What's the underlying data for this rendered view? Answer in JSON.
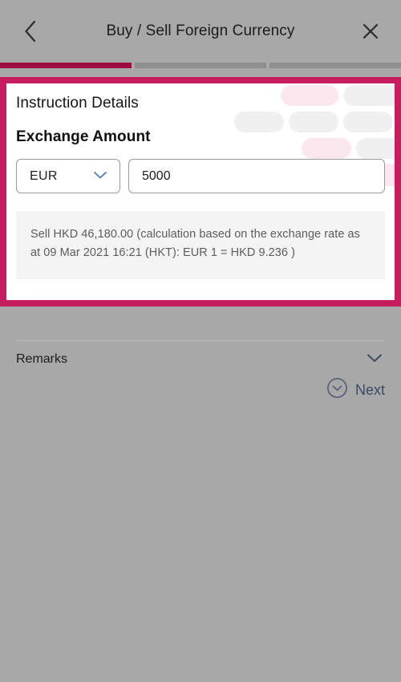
{
  "header": {
    "title": "Buy / Sell Foreign Currency",
    "back_icon": "chevron-left-icon",
    "close_icon": "close-x-icon"
  },
  "progress": {
    "steps": [
      {
        "state": "done",
        "color": "#9c0b3f"
      },
      {
        "state": "todo",
        "color": "#8f8f8f"
      },
      {
        "state": "todo",
        "color": "#8f8f8f"
      }
    ]
  },
  "card": {
    "highlight_color": "#c71c5e",
    "section_title": "Instruction Details",
    "field_label": "Exchange Amount",
    "currency": {
      "selected": "EUR",
      "chevron_icon": "chevron-down-icon",
      "chevron_color": "#4a7ebb"
    },
    "amount": {
      "value": "5000",
      "placeholder": "Amount"
    },
    "info_text": "Sell HKD 46,180.00 (calculation based on the exchange rate as at 09 Mar 2021 16:21 (HKT): EUR 1 = HKD 9.236 )"
  },
  "remarks": {
    "label": "Remarks",
    "chevron_icon": "chevron-down-icon"
  },
  "next": {
    "label": "Next",
    "icon": "circle-chevron-down-icon",
    "color": "#3b4a63"
  }
}
